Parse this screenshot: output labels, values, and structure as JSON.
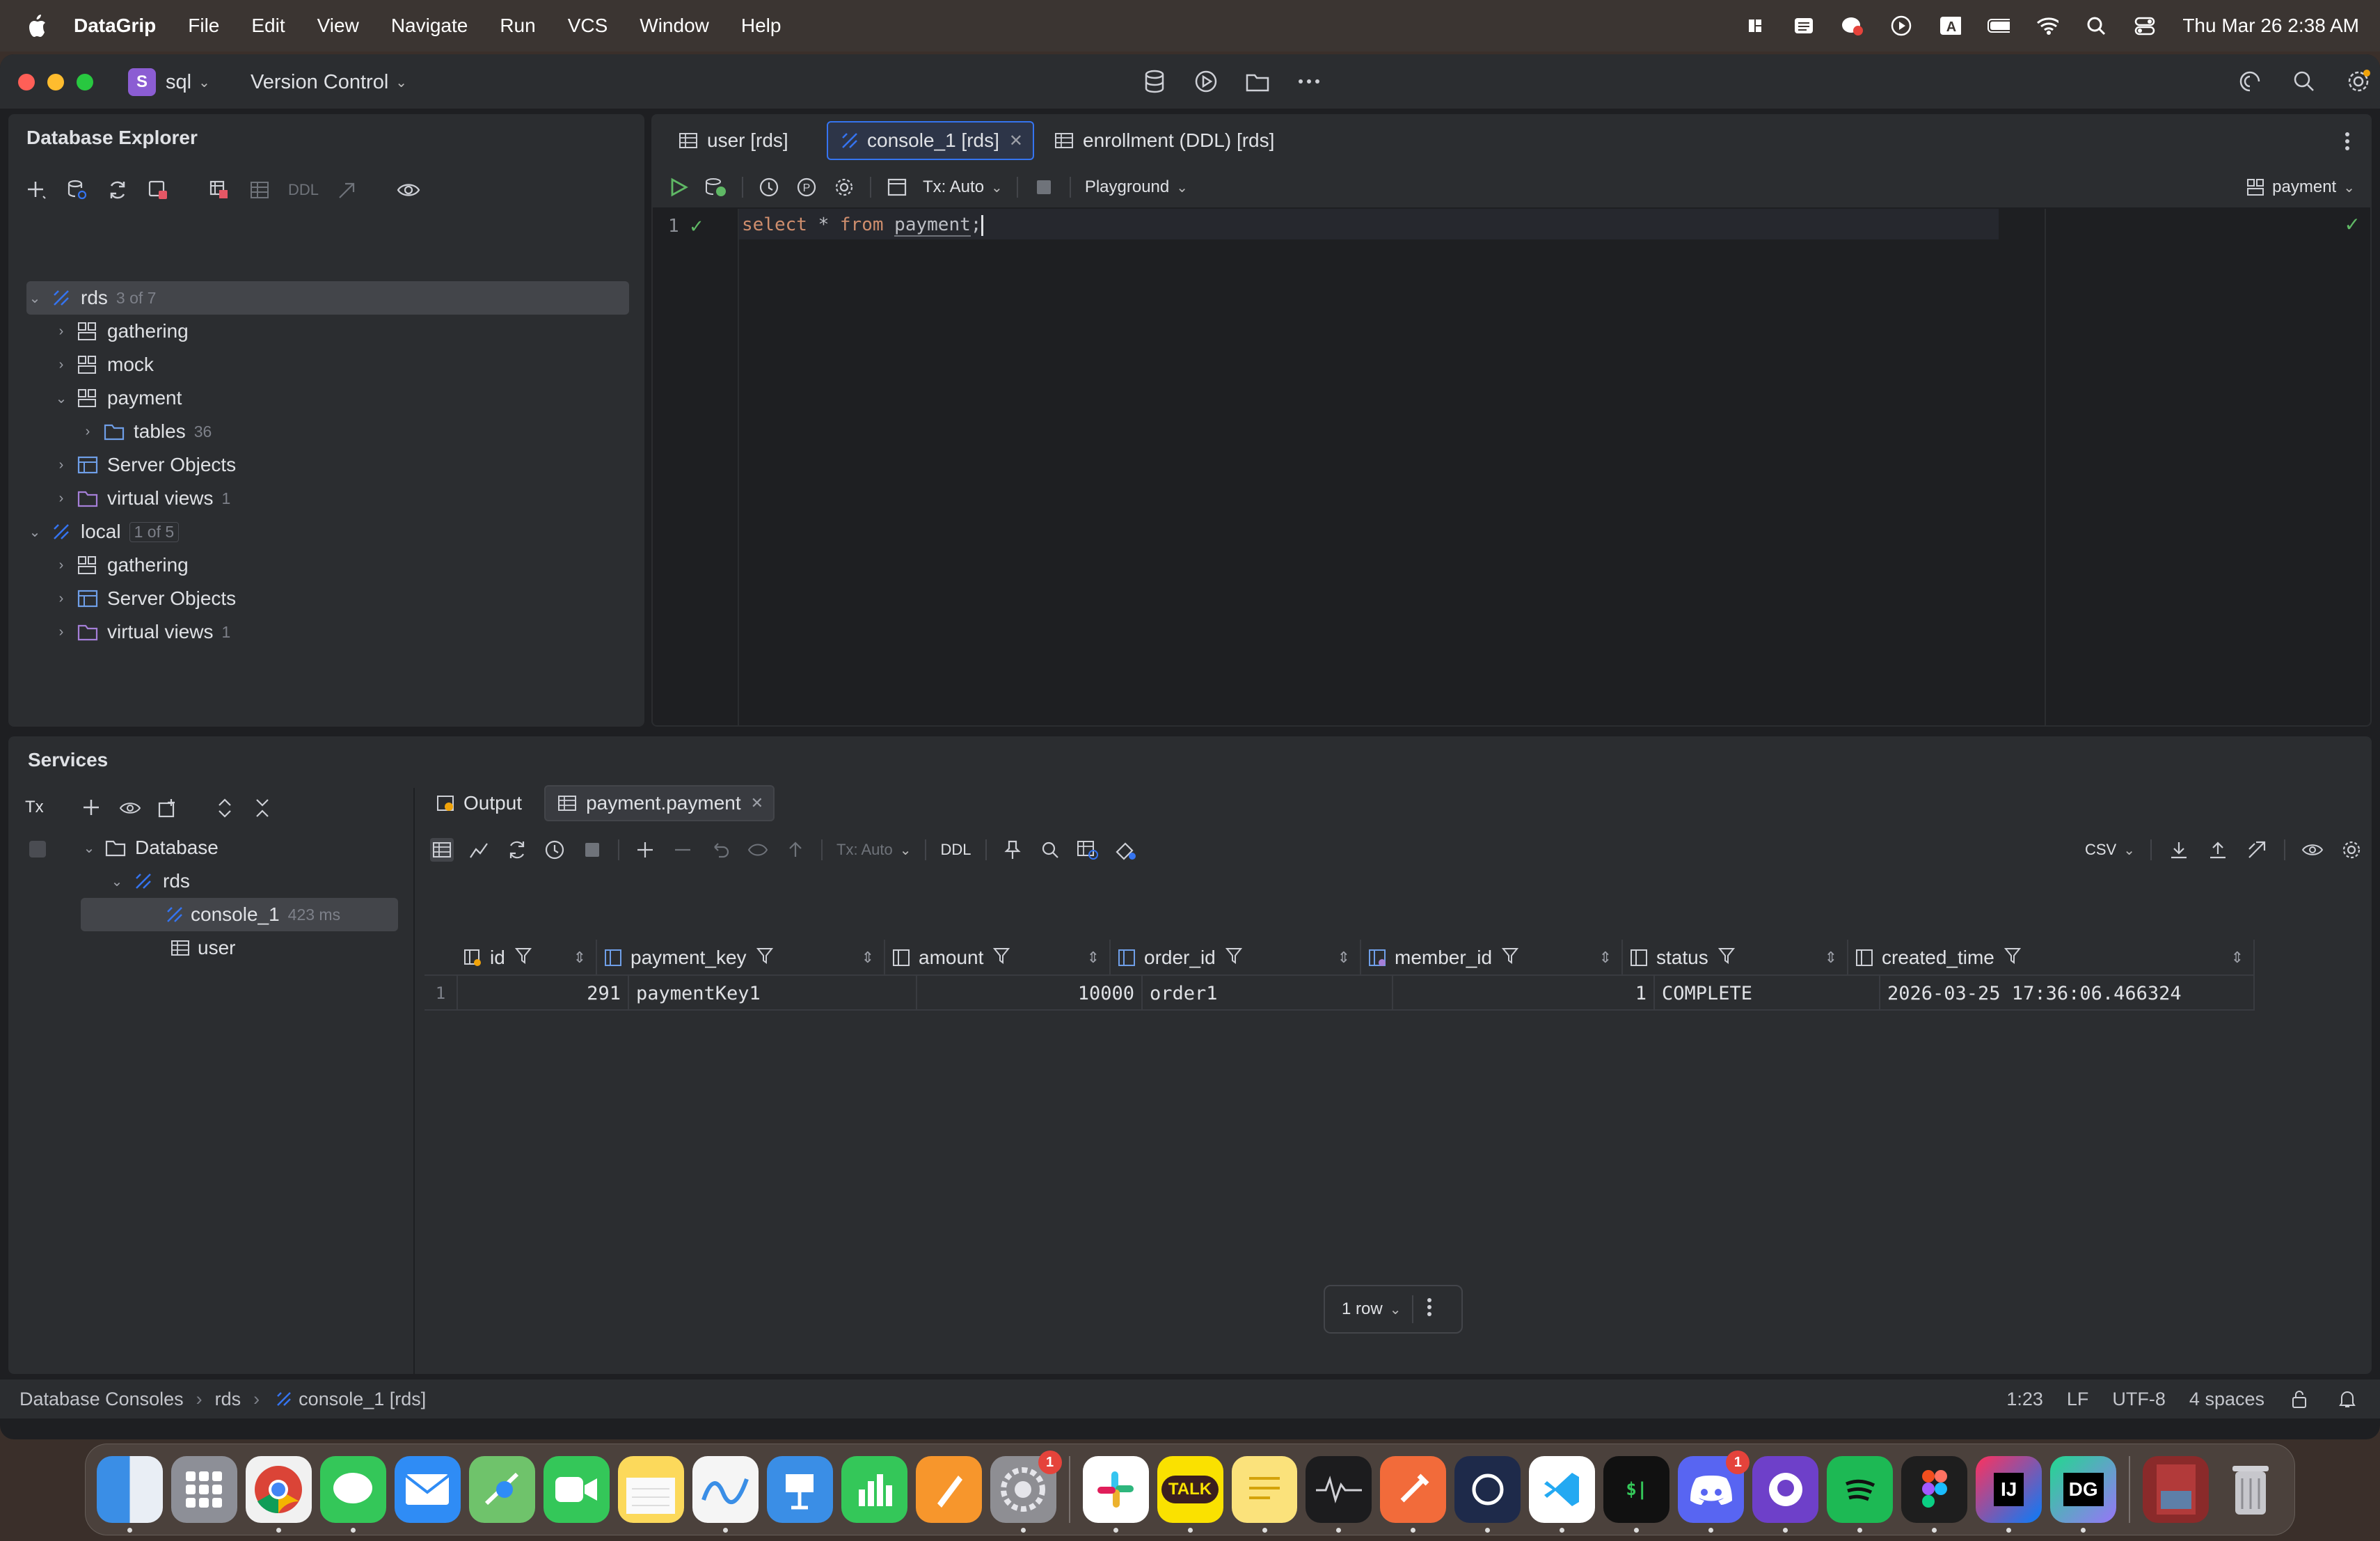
{
  "menubar": {
    "app_name": "DataGrip",
    "items": [
      "File",
      "Edit",
      "View",
      "Navigate",
      "Run",
      "VCS",
      "Window",
      "Help"
    ],
    "clock": "Thu Mar 26  2:38 AM"
  },
  "titlebar": {
    "project_badge": "S",
    "project_name": "sql",
    "vcs_label": "Version Control"
  },
  "db_explorer": {
    "title": "Database Explorer",
    "toolbar_ddl": "DDL",
    "tree": [
      {
        "label": "rds",
        "count": "3 of 7"
      },
      {
        "label": "gathering"
      },
      {
        "label": "mock"
      },
      {
        "label": "payment"
      },
      {
        "label": "tables",
        "count": "36"
      },
      {
        "label": "Server Objects"
      },
      {
        "label": "virtual views",
        "count": "1"
      },
      {
        "label": "local",
        "count": "1 of 5"
      },
      {
        "label": "gathering"
      },
      {
        "label": "Server Objects"
      },
      {
        "label": "virtual views",
        "count": "1"
      }
    ]
  },
  "editor": {
    "tabs": [
      {
        "label": "user [rds]"
      },
      {
        "label": "console_1 [rds]"
      },
      {
        "label": "enrollment (DDL) [rds]"
      }
    ],
    "tx_label": "Tx: Auto",
    "playground_label": "Playground",
    "schema_label": "payment",
    "line_number": "1",
    "code": {
      "kw1": "select",
      "star": "*",
      "kw2": "from",
      "ident": "payment",
      "semi": ";"
    }
  },
  "services": {
    "title": "Services",
    "tx_icon_label": "Tx",
    "tree": [
      {
        "label": "Database"
      },
      {
        "label": "rds"
      },
      {
        "label": "console_1",
        "time": "423 ms"
      },
      {
        "label": "user"
      }
    ],
    "tabs": [
      {
        "label": "Output"
      },
      {
        "label": "payment.payment"
      }
    ],
    "toolbar_tx": "Tx: Auto",
    "toolbar_ddl": "DDL",
    "export_format": "CSV",
    "columns": [
      "id",
      "payment_key",
      "amount",
      "order_id",
      "member_id",
      "status",
      "created_time"
    ],
    "rows": [
      {
        "num": "1",
        "id": "291",
        "payment_key": "paymentKey1",
        "amount": "10000",
        "order_id": "order1",
        "member_id": "1",
        "status": "COMPLETE",
        "created_time": "2026-03-25 17:36:06.466324"
      }
    ],
    "row_count": "1 row"
  },
  "statusbar": {
    "breadcrumb": [
      "Database Consoles",
      "rds",
      "console_1 [rds]"
    ],
    "position": "1:23",
    "line_ending": "LF",
    "encoding": "UTF-8",
    "indent": "4 spaces"
  },
  "dock": {
    "settings_badge": "1",
    "discord_badge": "1",
    "intellij_label": "IJ",
    "datagrip_label": "DG",
    "kakao_label": "TALK",
    "terminal_label": "$|"
  },
  "colors": {
    "accent": "#3574f0",
    "keyword": "#cf8e6d",
    "run_green": "#5fb865",
    "folder_purple": "#a57fd8"
  }
}
